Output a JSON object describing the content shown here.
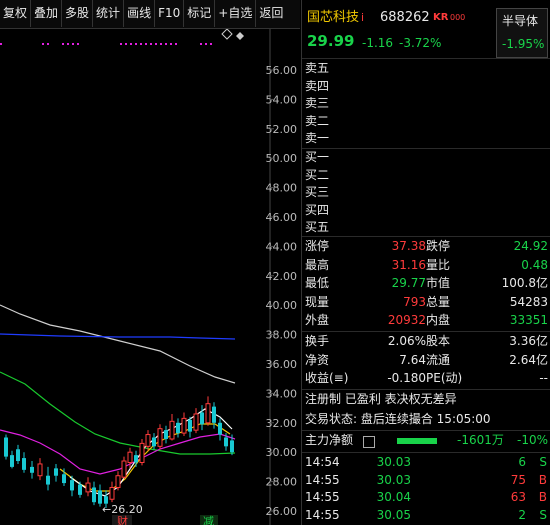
{
  "toolbar": [
    "复权",
    "叠加",
    "多股",
    "统计",
    "画线",
    "F10",
    "标记",
    "+自选",
    "返回"
  ],
  "chart": {
    "price_ticks": [
      "56.00",
      "54.00",
      "52.00",
      "50.00",
      "48.00",
      "46.00",
      "44.00",
      "42.00",
      "40.00",
      "38.00",
      "36.00",
      "34.00",
      "32.00",
      "30.00",
      "28.00",
      "26.00"
    ],
    "low_label": "←26.20",
    "marker_cai": "财",
    "marker_jian": "减"
  },
  "stock": {
    "name": "国芯科技",
    "info_icon": "i",
    "code": "688262",
    "kr_tag": "KR",
    "kr_num": "000",
    "price": "29.99",
    "change": "-1.16",
    "change_pct": "-3.72%",
    "sector": "半导体",
    "sector_pct": "-1.95%"
  },
  "orderbook": {
    "sell": [
      "卖五",
      "卖四",
      "卖三",
      "卖二",
      "卖一"
    ],
    "buy": [
      "买一",
      "买二",
      "买三",
      "买四",
      "买五"
    ]
  },
  "stats": [
    {
      "l1": "涨停",
      "v1": "37.38",
      "c1": "red",
      "l2": "跌停",
      "v2": "24.92",
      "c2": "green"
    },
    {
      "l1": "最高",
      "v1": "31.16",
      "c1": "red",
      "l2": "量比",
      "v2": "0.48",
      "c2": "green"
    },
    {
      "l1": "最低",
      "v1": "29.77",
      "c1": "green",
      "l2": "市值",
      "v2": "100.8亿",
      "c2": "white"
    },
    {
      "l1": "现量",
      "v1": "793",
      "c1": "red",
      "l2": "总量",
      "v2": "54283",
      "c2": "white"
    },
    {
      "l1": "外盘",
      "v1": "20932",
      "c1": "red",
      "l2": "内盘",
      "v2": "33351",
      "c2": "green"
    }
  ],
  "fundamentals": [
    {
      "l1": "换手",
      "v1": "2.06%",
      "l2": "股本",
      "v2": "3.36亿"
    },
    {
      "l1": "净资",
      "v1": "7.64",
      "l2": "流通",
      "v2": "2.64亿"
    },
    {
      "l1": "收益(≡)",
      "v1": "-0.180",
      "l2": "PE(动)",
      "v2": "--"
    }
  ],
  "notes": {
    "line1": "注册制  已盈利  表决权无差异",
    "line2": "交易状态: 盘后连续撮合 15:05:00"
  },
  "netflow": {
    "label": "主力净额",
    "value": "-1601万",
    "pct": "-10%"
  },
  "ticks": [
    {
      "time": "14:54",
      "price": "30.03",
      "vol": "6",
      "dir": "S"
    },
    {
      "time": "14:55",
      "price": "30.03",
      "vol": "75",
      "dir": "B"
    },
    {
      "time": "14:55",
      "price": "30.04",
      "vol": "63",
      "dir": "B"
    },
    {
      "time": "14:55",
      "price": "30.05",
      "vol": "2",
      "dir": "S"
    }
  ],
  "colors": {
    "up": "#ff3b3b",
    "down": "#19d34a",
    "ma5": "#ffffff",
    "ma10": "#f0c800",
    "ma20": "#e020e0",
    "ma60": "#19c92e",
    "ma120": "#cfcfcf",
    "ma250": "#1f3cff"
  }
}
